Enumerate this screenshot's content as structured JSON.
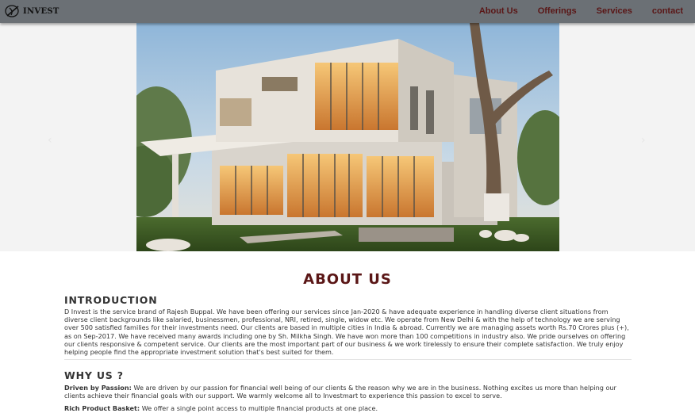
{
  "brand": {
    "name": "INVEST"
  },
  "nav": {
    "items": [
      "About Us",
      "Offerings",
      "Services",
      "contact"
    ]
  },
  "carousel": {
    "prev_icon": "chevron-left-icon",
    "next_icon": "chevron-right-icon",
    "prev_glyph": "‹",
    "next_glyph": "›"
  },
  "about": {
    "title": "ABOUT US",
    "intro_heading": "INTRODUCTION",
    "intro_text": "D Invest is the service brand of Rajesh Buppal. We have been offering our services since Jan-2020 & have adequate experience in handling diverse client situations from diverse client backgrounds like salaried, businessmen, professional, NRI, retired, single, widow etc. We operate from New Delhi & with the help of technology we are serving over 500 satisfied families for their investments need. Our clients are based in multiple cities in India & abroad. Currently we are managing assets worth Rs.70 Crores plus (+), as on Sep-2017. We have received many awards including one by Sh. Milkha Singh. We have won more than 100 competitions in industry also. We pride ourselves on offering our clients responsive & competent service. Our clients are the most important part of our business & we work tirelessly to ensure their complete satisfaction. We truly enjoy helping people find the appropriate investment solution that's best suited for them.",
    "why_heading": "WHY US ?",
    "why_points": [
      {
        "label": "Driven by Passion:",
        "text": " We are driven by our passion for financial well being of our clients & the reason why we are in the business. Nothing excites us more than helping our clients achieve their financial goals with our support. We warmly welcome all to Investmart to experience this passion to excel to serve."
      },
      {
        "label": "Rich Product Basket:",
        "text": " We offer a single point access to multiple financial products at one place."
      }
    ]
  }
}
